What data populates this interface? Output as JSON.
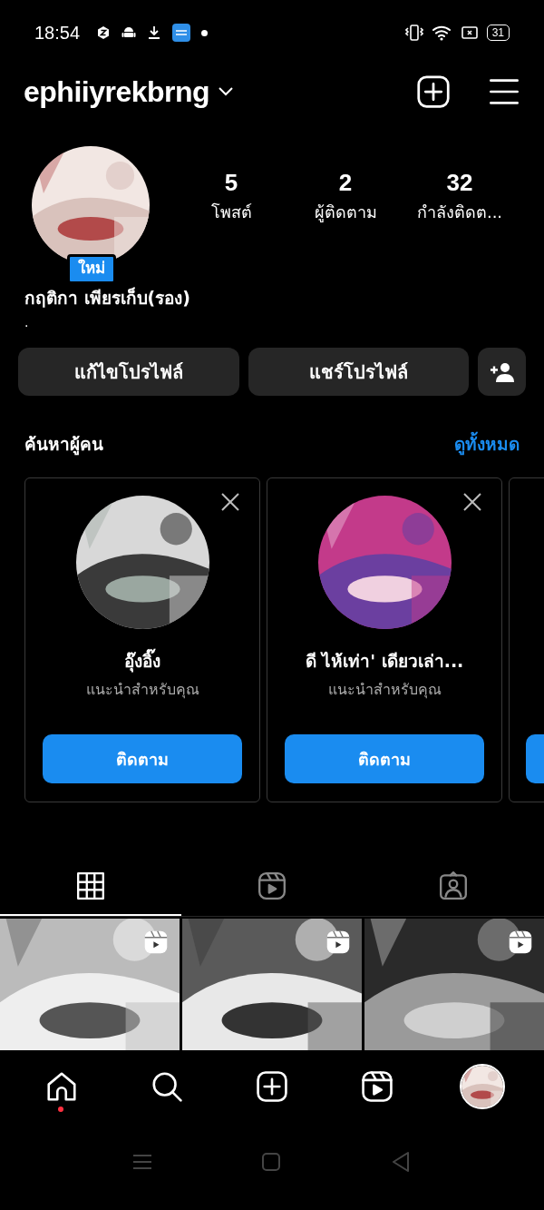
{
  "status_bar": {
    "time": "18:54",
    "battery": "31"
  },
  "header": {
    "username": "ephiiyrekbrng"
  },
  "profile": {
    "new_badge": "ใหม่",
    "name": "กฤติกา เพียรเก็บ(รอง)",
    "bio": ".",
    "stats": [
      {
        "value": "5",
        "label": "โพสต์"
      },
      {
        "value": "2",
        "label": "ผู้ติดตาม"
      },
      {
        "value": "32",
        "label": "กำลังติดต..."
      }
    ]
  },
  "actions": [
    "แก้ไขโปรไฟล์",
    "แชร์โปรไฟล์"
  ],
  "discover": {
    "title": "ค้นหาผู้คน",
    "see_all": "ดูทั้งหมด",
    "cards": [
      {
        "kind": "full",
        "name": "อุ๊งอิ๊ง",
        "subtitle": "แนะนำสำหรับคุณ",
        "button": "ติดตาม"
      },
      {
        "kind": "full",
        "name": "ดี ไห้เท่า' เดียวเล่า...",
        "subtitle": "แนะนำสำหรับคุณ",
        "button": "ติดตาม"
      },
      {
        "kind": "partial"
      }
    ]
  },
  "content_tabs": [
    {
      "kind": "grid",
      "selected": true
    },
    {
      "kind": "reels",
      "selected": false
    },
    {
      "kind": "tagged",
      "selected": false
    }
  ],
  "posts": [
    {
      "kind": "picture",
      "reel": true
    },
    {
      "kind": "picture",
      "reel": true
    },
    {
      "kind": "picture",
      "reel": true
    }
  ],
  "bottom_nav": [
    {
      "kind": "home",
      "notification": true
    },
    {
      "kind": "search",
      "notification": false
    },
    {
      "kind": "create",
      "notification": false
    },
    {
      "kind": "reels",
      "notification": false
    },
    {
      "kind": "profile",
      "notification": false
    }
  ]
}
